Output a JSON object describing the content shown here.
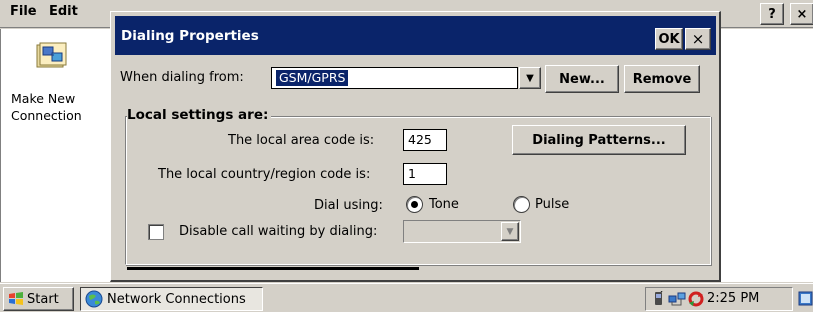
{
  "menubar": {
    "file": "File",
    "edit": "Edit",
    "help": "?",
    "close": "×"
  },
  "desktop": {
    "connection_label": "Make New Connection"
  },
  "dialog": {
    "title": "Dialing Properties",
    "ok": "OK",
    "close": "×",
    "when_dialing_label": "When dialing from:",
    "when_dialing_value": "GSM/GPRS",
    "new_button": "New...",
    "remove_button": "Remove",
    "group_title": "Local settings are:",
    "area_code_label": "The local area code is:",
    "area_code_value": "425",
    "dialing_patterns_button": "Dialing Patterns...",
    "country_code_label": "The local country/region code is:",
    "country_code_value": "1",
    "dial_using_label": "Dial using:",
    "tone_label": "Tone",
    "pulse_label": "Pulse",
    "dial_using_selected": "Tone",
    "disable_cw_label": "Disable call waiting by dialing:",
    "disable_cw_checked": false,
    "disable_cw_value": ""
  },
  "taskbar": {
    "start": "Start",
    "task": "Network Connections",
    "clock": "2:25 PM"
  },
  "icons": {
    "connection": "network-connection-icon",
    "start": "windows-flag-icon",
    "task": "network-globe-icon",
    "tray": [
      "phone-icon",
      "network-icon",
      "sync-icon"
    ],
    "desktop": "show-desktop-icon"
  },
  "colors": {
    "titlebar": "#0a246a",
    "selection": "#0a246a",
    "face": "#d4d0c8",
    "desktop": "#ffffff"
  }
}
